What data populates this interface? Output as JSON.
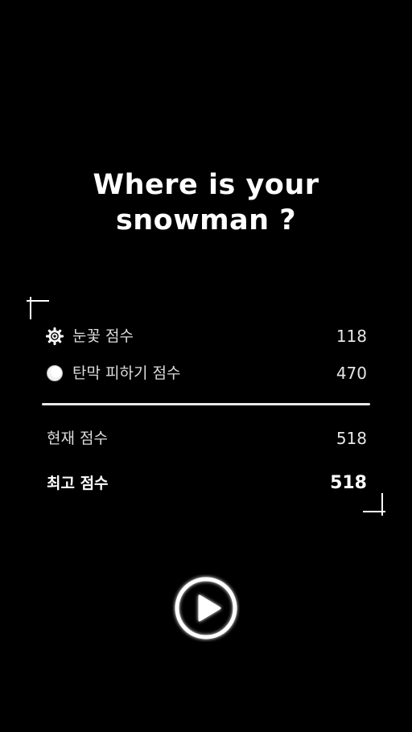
{
  "title": {
    "line1": "Where is your",
    "line2": "snowman ?"
  },
  "scores": {
    "snowflake": {
      "icon": "snowflake-icon",
      "label": "눈꽃 점수",
      "value": "118"
    },
    "dodge": {
      "icon": "moon-icon",
      "label": "탄막 피하기 점수",
      "value": "470"
    },
    "current": {
      "label": "현재 점수",
      "value": "518"
    },
    "best": {
      "label": "최고 점수",
      "value": "518"
    }
  },
  "play": {
    "icon": "play-icon"
  },
  "colors": {
    "background": "#000000",
    "text": "#ffffff",
    "muted_text": "#dcdcdc",
    "divider": "#e8e8e8"
  }
}
